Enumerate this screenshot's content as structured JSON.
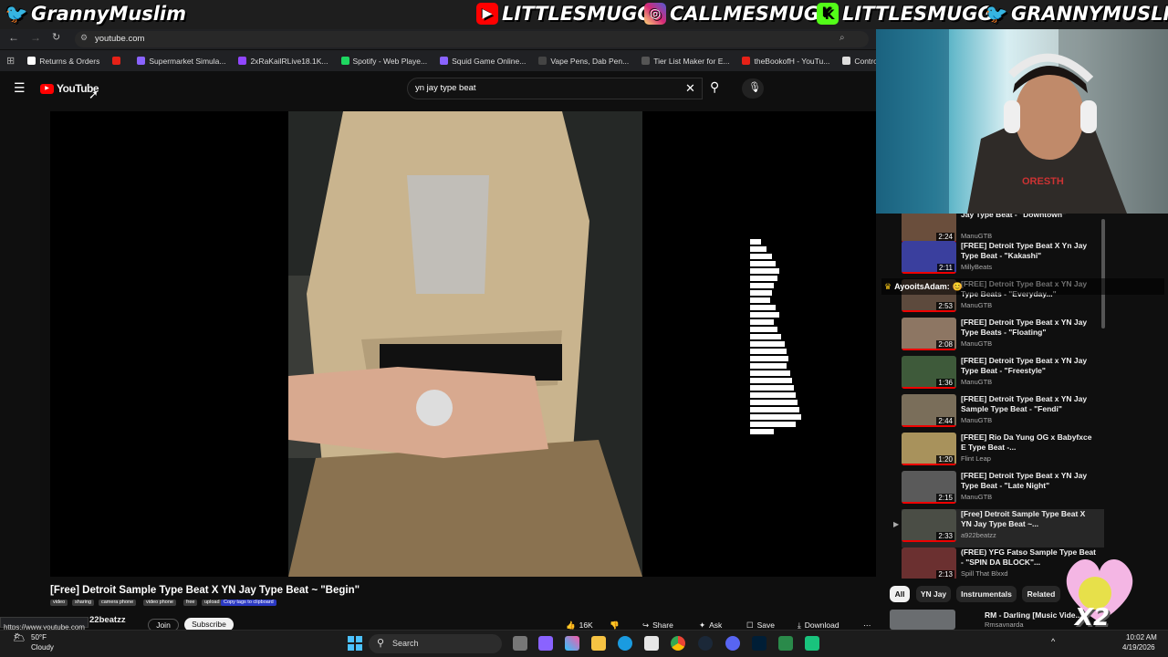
{
  "overlay": {
    "left_handle": "GrannyMuslim",
    "youtube_handle": "LITTLESMUGG",
    "instagram_handle": "CALLMESMUGG",
    "kick_handle": "LITTLESMUGG",
    "twitter_handle": "GRANNYMUSLIM",
    "x2_label": "X2",
    "chat_name": "AyooitsAdam:"
  },
  "browser": {
    "url": "youtube.com",
    "bookmarks": [
      {
        "label": "Returns & Orders",
        "color": "#ffffff"
      },
      {
        "label": "",
        "color": "#e62117"
      },
      {
        "label": "Supermarket Simula...",
        "color": "#8a63ff"
      },
      {
        "label": "2xRaKailRLive18.1K...",
        "color": "#9146ff"
      },
      {
        "label": "Spotify - Web Playe...",
        "color": "#1ed760"
      },
      {
        "label": "Squid Game Online...",
        "color": "#8a63ff"
      },
      {
        "label": "Vape Pens, Dab Pen...",
        "color": "#444444"
      },
      {
        "label": "Tier List Maker for E...",
        "color": "#555555"
      },
      {
        "label": "theBookofH - YouTu...",
        "color": "#e62117"
      },
      {
        "label": "Control Room",
        "color": "#dddddd"
      }
    ]
  },
  "youtube": {
    "logo_text": "YouTube",
    "search_value": "yn jay type beat",
    "video_title": "[Free] Detroit Sample Type Beat X YN Jay Type Beat ~ \"Begin\"",
    "tags": [
      "video",
      "sharing",
      "camera phone",
      "video phone",
      "free",
      "upload"
    ],
    "copy_tags": "Copy tags to clipboard",
    "channel": "22beatzz",
    "join": "Join",
    "subscribe": "Subscribe",
    "likes": "16K",
    "share": "Share",
    "ask": "Ask",
    "save": "Save",
    "download": "Download",
    "status_url": "https://www.youtube.com",
    "chips": [
      "All",
      "YN Jay",
      "Instrumentals",
      "Related"
    ],
    "related": [
      {
        "title": "Jay Type Beat - \"Downtown\"",
        "channel": "ManuGTB",
        "duration": "2:24",
        "color": "#6a4e3c"
      },
      {
        "title": "[FREE] Detroit Type Beat X Yn Jay Type Beat - \"Kakashi\"",
        "channel": "MillyBeats",
        "duration": "2:11",
        "color": "#3a3f9e"
      },
      {
        "title": "[FREE] Detroit Type Beat x YN Jay Type Beats - \"Everyday...\"",
        "channel": "ManuGTB",
        "duration": "2:53",
        "color": "#5d4a3d"
      },
      {
        "title": "[FREE] Detroit Type Beat x YN Jay Type Beats - \"Floating\"",
        "channel": "ManuGTB",
        "duration": "2:08",
        "color": "#8d7663"
      },
      {
        "title": "[FREE] Detroit Type Beat x YN Jay Type Beat - \"Freestyle\"",
        "channel": "ManuGTB",
        "duration": "1:36",
        "color": "#3e5a3a"
      },
      {
        "title": "[FREE] Detroit Type Beat x YN Jay Sample Type Beat - \"Fendi\"",
        "channel": "ManuGTB",
        "duration": "2:44",
        "color": "#7a6e5a"
      },
      {
        "title": "[FREE] Rio Da Yung OG x Babyfxce E Type Beat -...",
        "channel": "Flint Leap",
        "duration": "1:20",
        "color": "#a8925c"
      },
      {
        "title": "[FREE] Detroit Type Beat x YN Jay Type Beat - \"Late Night\"",
        "channel": "ManuGTB",
        "duration": "2:15",
        "color": "#5a5a5a"
      },
      {
        "title": "[Free] Detroit Sample Type Beat X YN Jay Type Beat ~...",
        "channel": "a922beatzz",
        "duration": "2:33",
        "color": "#4a4d45"
      },
      {
        "title": "(FREE) YFG Fatso Sample Type Beat - \"SPIN DA BLOCK\"...",
        "channel": "Spill That Blxxd",
        "duration": "2:13",
        "color": "#6b3030"
      }
    ],
    "next_title": "RM - Darling [Music Vide...",
    "next_channel": "Rmsavnarda"
  },
  "taskbar": {
    "temp": "50°F",
    "weather": "Cloudy",
    "search": "Search",
    "time": "10:02 AM",
    "date": "4/19/2026"
  },
  "colors": {
    "yt_red": "#ff0000",
    "overlay_bg": "#1e1e1e",
    "kick_green": "#53fc18",
    "instagram": "#d6249f",
    "twitter_blue": "#1d9bf0"
  }
}
